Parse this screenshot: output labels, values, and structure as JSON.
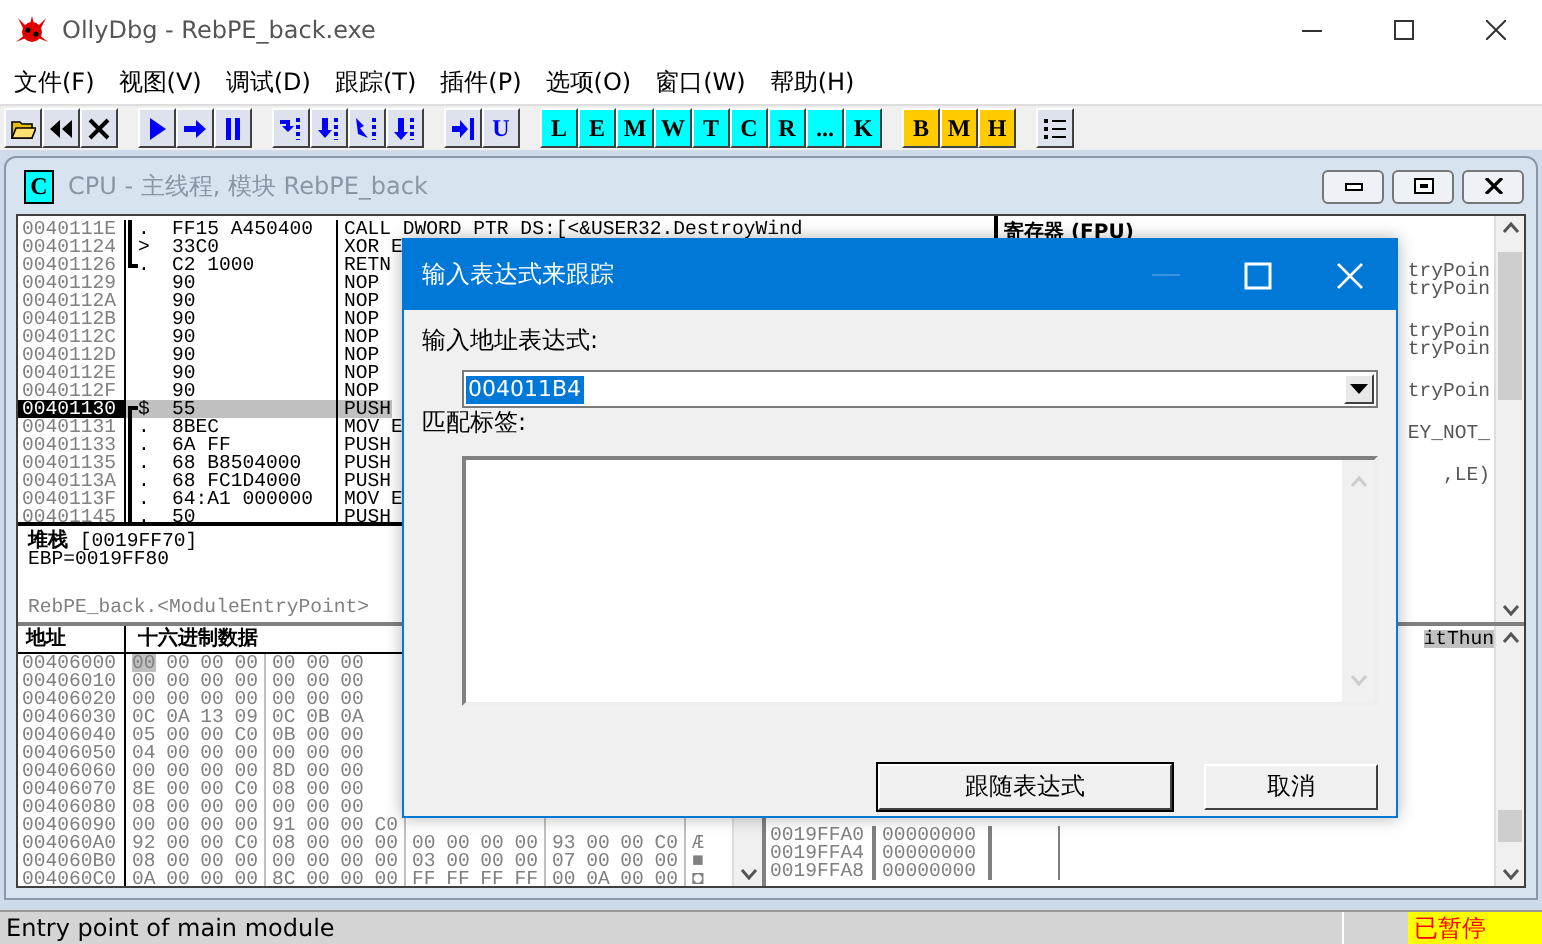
{
  "window": {
    "title": "OllyDbg - RebPE_back.exe"
  },
  "menu": [
    "文件(F)",
    "视图(V)",
    "调试(D)",
    "跟踪(T)",
    "插件(P)",
    "选项(O)",
    "窗口(W)",
    "帮助(H)"
  ],
  "toolbar": {
    "letter_groups": [
      [
        {
          "label": "U",
          "color": "#dde2ec"
        }
      ],
      [
        {
          "label": "L",
          "color": "#00ffff"
        },
        {
          "label": "E",
          "color": "#00ffff"
        },
        {
          "label": "M",
          "color": "#00ffff"
        },
        {
          "label": "W",
          "color": "#00ffff"
        },
        {
          "label": "T",
          "color": "#00ffff"
        },
        {
          "label": "C",
          "color": "#00ffff"
        },
        {
          "label": "R",
          "color": "#00ffff"
        },
        {
          "label": "...",
          "color": "#00ffff"
        },
        {
          "label": "K",
          "color": "#00ffff"
        }
      ],
      [
        {
          "label": "B",
          "color": "#ffcc00"
        },
        {
          "label": "M",
          "color": "#ffcc00"
        },
        {
          "label": "H",
          "color": "#ffcc00"
        }
      ]
    ]
  },
  "cpu_window": {
    "icon_label": "C",
    "title": "CPU - 主线程, 模块 RebPE_back"
  },
  "disasm": [
    {
      "address": "0040111E",
      "mark": ".",
      "kind": "bracket-mid",
      "hex": "FF15 A450400",
      "code": "CALL DWORD PTR DS:[<&USER32.DestroyWind",
      "selected": false
    },
    {
      "address": "00401124",
      "mark": ">",
      "kind": "bracket-mid",
      "hex": "33C0",
      "code": "XOR E",
      "selected": false
    },
    {
      "address": "00401126",
      "mark": ".",
      "kind": "bracket-end",
      "hex": "C2 1000",
      "code": "RETN",
      "selected": false
    },
    {
      "address": "00401129",
      "hex": "90",
      "code": "NOP",
      "selected": false
    },
    {
      "address": "0040112A",
      "hex": "90",
      "code": "NOP",
      "selected": false
    },
    {
      "address": "0040112B",
      "hex": "90",
      "code": "NOP",
      "selected": false
    },
    {
      "address": "0040112C",
      "hex": "90",
      "code": "NOP",
      "selected": false
    },
    {
      "address": "0040112D",
      "hex": "90",
      "code": "NOP",
      "selected": false
    },
    {
      "address": "0040112E",
      "hex": "90",
      "code": "NOP",
      "selected": false
    },
    {
      "address": "0040112F",
      "hex": "90",
      "code": "NOP",
      "selected": false
    },
    {
      "address": "00401130",
      "mark": "$",
      "kind": "bracket-start",
      "hex": "55",
      "code": "PUSH",
      "selected": true
    },
    {
      "address": "00401131",
      "mark": ".",
      "kind": "bracket-mid",
      "hex": "8BEC",
      "code": "MOV E",
      "selected": false
    },
    {
      "address": "00401133",
      "mark": ".",
      "kind": "bracket-mid",
      "hex": "6A FF",
      "code": "PUSH",
      "selected": false
    },
    {
      "address": "00401135",
      "mark": ".",
      "kind": "bracket-mid",
      "hex": "68 B8504000",
      "code": "PUSH",
      "selected": false
    },
    {
      "address": "0040113A",
      "mark": ".",
      "kind": "bracket-mid",
      "hex": "68 FC1D4000",
      "code": "PUSH",
      "selected": false
    },
    {
      "address": "0040113F",
      "mark": ".",
      "kind": "bracket-mid",
      "hex": "64:A1 000000",
      "code": "MOV E",
      "selected": false
    },
    {
      "address": "00401145",
      "mark": ".",
      "kind": "bracket-mid",
      "hex": "50",
      "code": "PUSH",
      "selected": false
    }
  ],
  "info": {
    "lines": [
      "**堆栈** [0019FF70]",
      "EBP=0019FF80"
    ],
    "label": "RebPE_back.<ModuleEntryPoint>"
  },
  "registers": {
    "header": "寄存器 (FPU)",
    "line_groups": [
      [
        "tryPoin",
        "tryPoin"
      ],
      [
        "tryPoin",
        "tryPoin"
      ],
      [
        "tryPoin"
      ],
      [
        "EY_NOT_"
      ],
      [
        ",LE)"
      ]
    ]
  },
  "dump": {
    "columns": [
      "地址",
      "十六进制数据"
    ],
    "rows": [
      {
        "address": "00406000",
        "bytes": [
          "00",
          "00",
          "00",
          "00",
          "00",
          "00",
          "00"
        ],
        "selected": true
      },
      {
        "address": "00406010",
        "bytes": [
          "00",
          "00",
          "00",
          "00",
          "00",
          "00",
          "00"
        ],
        "selected": false
      },
      {
        "address": "00406020",
        "bytes": [
          "00",
          "00",
          "00",
          "00",
          "00",
          "00",
          "00"
        ],
        "selected": false
      },
      {
        "address": "00406030",
        "bytes": [
          "0C",
          "0A",
          "13",
          "09",
          "0C",
          "0B",
          "0A"
        ],
        "selected": false
      },
      {
        "address": "00406040",
        "bytes": [
          "05",
          "00",
          "00",
          "C0",
          "0B",
          "00",
          "00"
        ],
        "selected": false
      },
      {
        "address": "00406050",
        "bytes": [
          "04",
          "00",
          "00",
          "00",
          "00",
          "00",
          "00"
        ],
        "selected": false
      },
      {
        "address": "00406060",
        "bytes": [
          "00",
          "00",
          "00",
          "00",
          "8D",
          "00",
          "00"
        ],
        "selected": false
      },
      {
        "address": "00406070",
        "bytes": [
          "8E",
          "00",
          "00",
          "C0",
          "08",
          "00",
          "00"
        ],
        "selected": false
      },
      {
        "address": "00406080",
        "bytes": [
          "08",
          "00",
          "00",
          "00",
          "00",
          "00",
          "00"
        ],
        "selected": false
      },
      {
        "address": "00406090",
        "bytes": [
          "00",
          "00",
          "00",
          "00",
          "91",
          "00",
          "00",
          "C0"
        ],
        "selected": false
      },
      {
        "address": "004060A0",
        "bytes": [
          "92",
          "00",
          "00",
          "C0",
          "08",
          "00",
          "00",
          "00",
          "00",
          "00",
          "00",
          "00",
          "93",
          "00",
          "00",
          "C0"
        ],
        "ascii": "Æ",
        "selected": false
      },
      {
        "address": "004060B0",
        "bytes": [
          "08",
          "00",
          "00",
          "00",
          "00",
          "00",
          "00",
          "00",
          "03",
          "00",
          "00",
          "00",
          "07",
          "00",
          "00",
          "00"
        ],
        "ascii": "■",
        "selected": false
      },
      {
        "address": "004060C0",
        "bytes": [
          "0A",
          "00",
          "00",
          "00",
          "8C",
          "00",
          "00",
          "00",
          "FF",
          "FF",
          "FF",
          "FF",
          "00",
          "0A",
          "00",
          "00"
        ],
        "ascii": "◘",
        "selected": false
      }
    ]
  },
  "stack": {
    "top_comment": "itThun",
    "rows": [
      {
        "address": "0019FFA0",
        "value": "00000000"
      },
      {
        "address": "0019FFA4",
        "value": "00000000"
      },
      {
        "address": "0019FFA8",
        "value": "00000000"
      }
    ]
  },
  "dialog": {
    "title": "输入表达式来跟踪",
    "minimize_disabled": true,
    "address_label": "输入地址表达式:",
    "address_value": "004011B4",
    "address_selected": true,
    "tag_label": "匹配标签:",
    "buttons": [
      {
        "label": "跟随表达式",
        "default": true
      },
      {
        "label": "取消",
        "default": false
      }
    ]
  },
  "status_bar": {
    "message": "Entry point of main module",
    "state": "已暂停"
  }
}
